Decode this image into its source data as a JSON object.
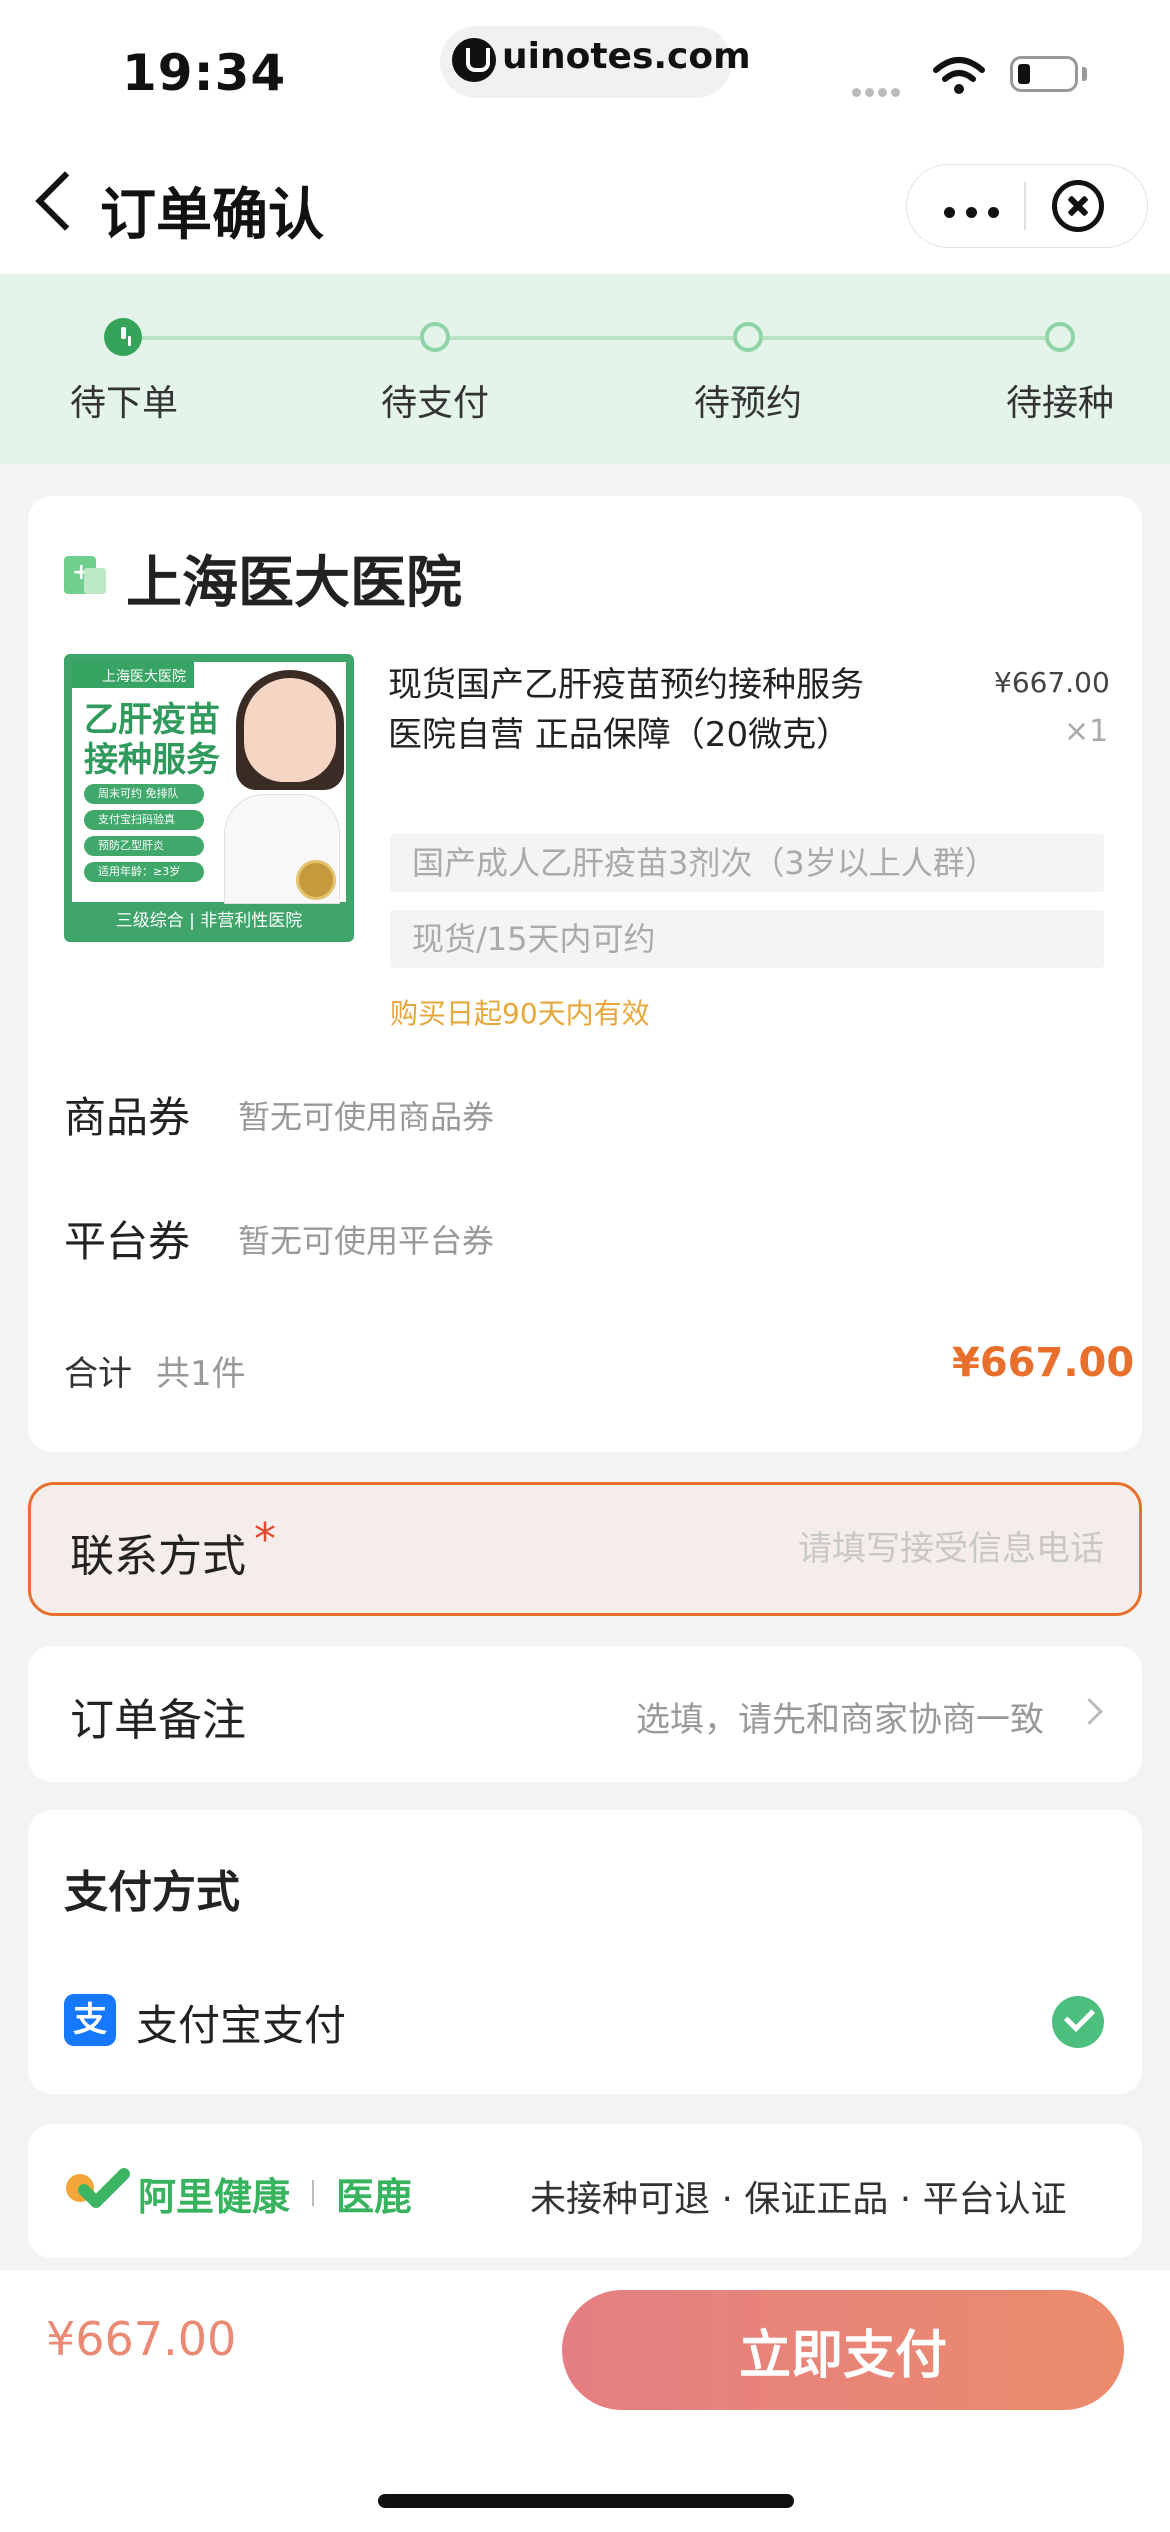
{
  "status_bar": {
    "time": "19:34",
    "url": "uinotes.com"
  },
  "nav": {
    "title": "订单确认"
  },
  "steps": [
    {
      "label": "待下单",
      "active": true
    },
    {
      "label": "待支付",
      "active": false
    },
    {
      "label": "待预约",
      "active": false
    },
    {
      "label": "待接种",
      "active": false
    }
  ],
  "order": {
    "hospital": "上海医大医院",
    "product": {
      "image_banner": "上海医大医院",
      "image_headline_1": "乙肝疫苗",
      "image_headline_2": "接种服务",
      "image_features": [
        "周末可约 免排队",
        "支付宝扫码验真",
        "预防乙型肝炎",
        "适用年龄：≥3岁"
      ],
      "image_footer": "三级综合 | 非营利性医院",
      "name": "现货国产乙肝疫苗预约接种服务 医院自营 正品保障（20微克）",
      "price": "¥667.00",
      "qty": "×1",
      "specs": [
        "国产成人乙肝疫苗3剂次（3岁以上人群）",
        "现货/15天内可约"
      ],
      "validity": "购买日起90天内有效"
    },
    "coupons": [
      {
        "label": "商品券",
        "hint": "暂无可使用商品券"
      },
      {
        "label": "平台券",
        "hint": "暂无可使用平台券"
      }
    ],
    "total": {
      "label": "合计",
      "count": "共1件",
      "amount": "¥667.00"
    }
  },
  "contact": {
    "label": "联系方式",
    "required_mark": "*",
    "placeholder": "请填写接受信息电话",
    "value": ""
  },
  "remark": {
    "label": "订单备注",
    "hint": "选填，请先和商家协商一致"
  },
  "payment": {
    "title": "支付方式",
    "method": "支付宝支付",
    "icon_char": "支",
    "selected": true
  },
  "brand": {
    "name": "阿里健康",
    "sub": "医鹿",
    "guarantees": "未接种可退 · 保证正品 · 平台认证"
  },
  "footer": {
    "total": "¥667.00",
    "pay_button": "立即支付"
  },
  "colors": {
    "accent": "#e86f2c",
    "green": "#36a35a",
    "pay_button": "#e98174"
  }
}
